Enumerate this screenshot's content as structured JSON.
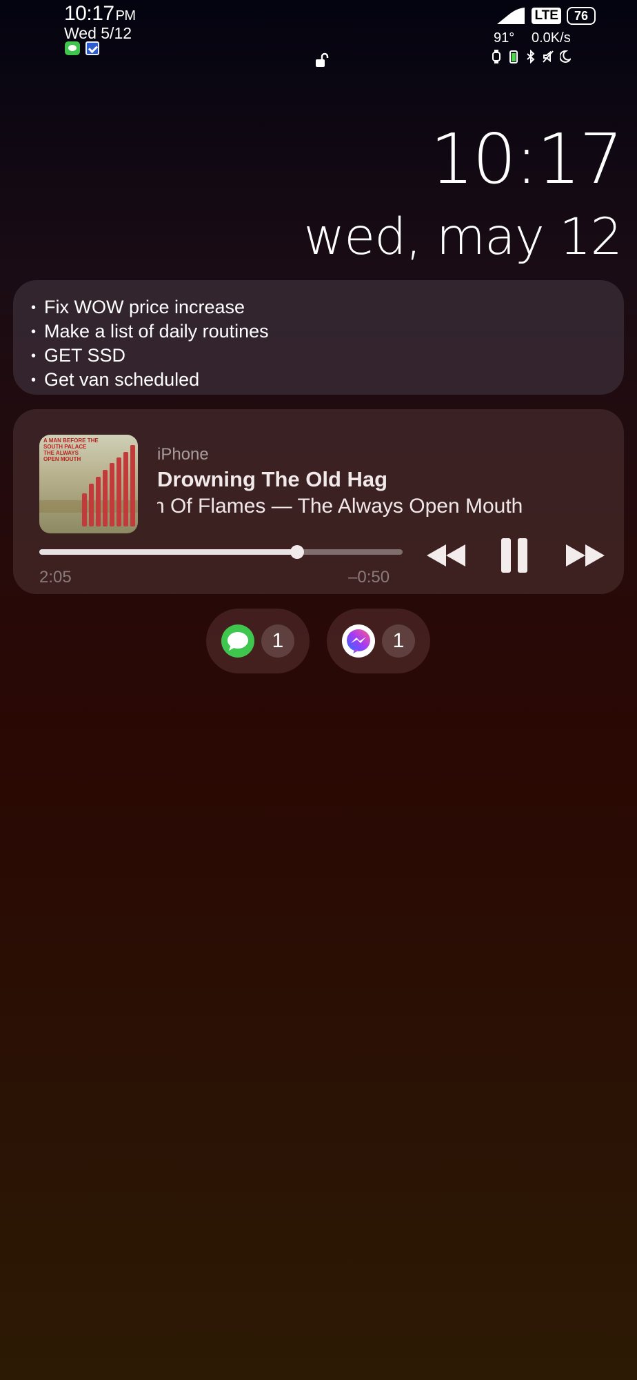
{
  "status_bar": {
    "time": "10:17",
    "ampm": "PM",
    "date": "Wed 5/12",
    "network": "LTE",
    "battery": "76",
    "temperature": "91°",
    "speed": "0.0K/s"
  },
  "clock": {
    "time": "10:17",
    "date": "wed, may 12"
  },
  "notes": {
    "items": [
      "Fix WOW price increase",
      "Make a list of daily routines",
      "GET SSD",
      "Get van scheduled"
    ]
  },
  "player": {
    "source": "iPhone",
    "title": "Drowning The Old Hag",
    "artist_album": "ch Of Flames — The Always Open Mouth",
    "elapsed": "2:05",
    "remaining": "–0:50",
    "progress": 0.71,
    "album_art_text": "A MAN BEFORE THE\nSOUTH PALACE\nTHE ALWAYS\nOPEN MOUTH"
  },
  "notifications": [
    {
      "app": "messages-icon",
      "count": "1",
      "color": "#3fc64f"
    },
    {
      "app": "messenger-icon",
      "count": "1",
      "color": "#a33bf5"
    }
  ]
}
